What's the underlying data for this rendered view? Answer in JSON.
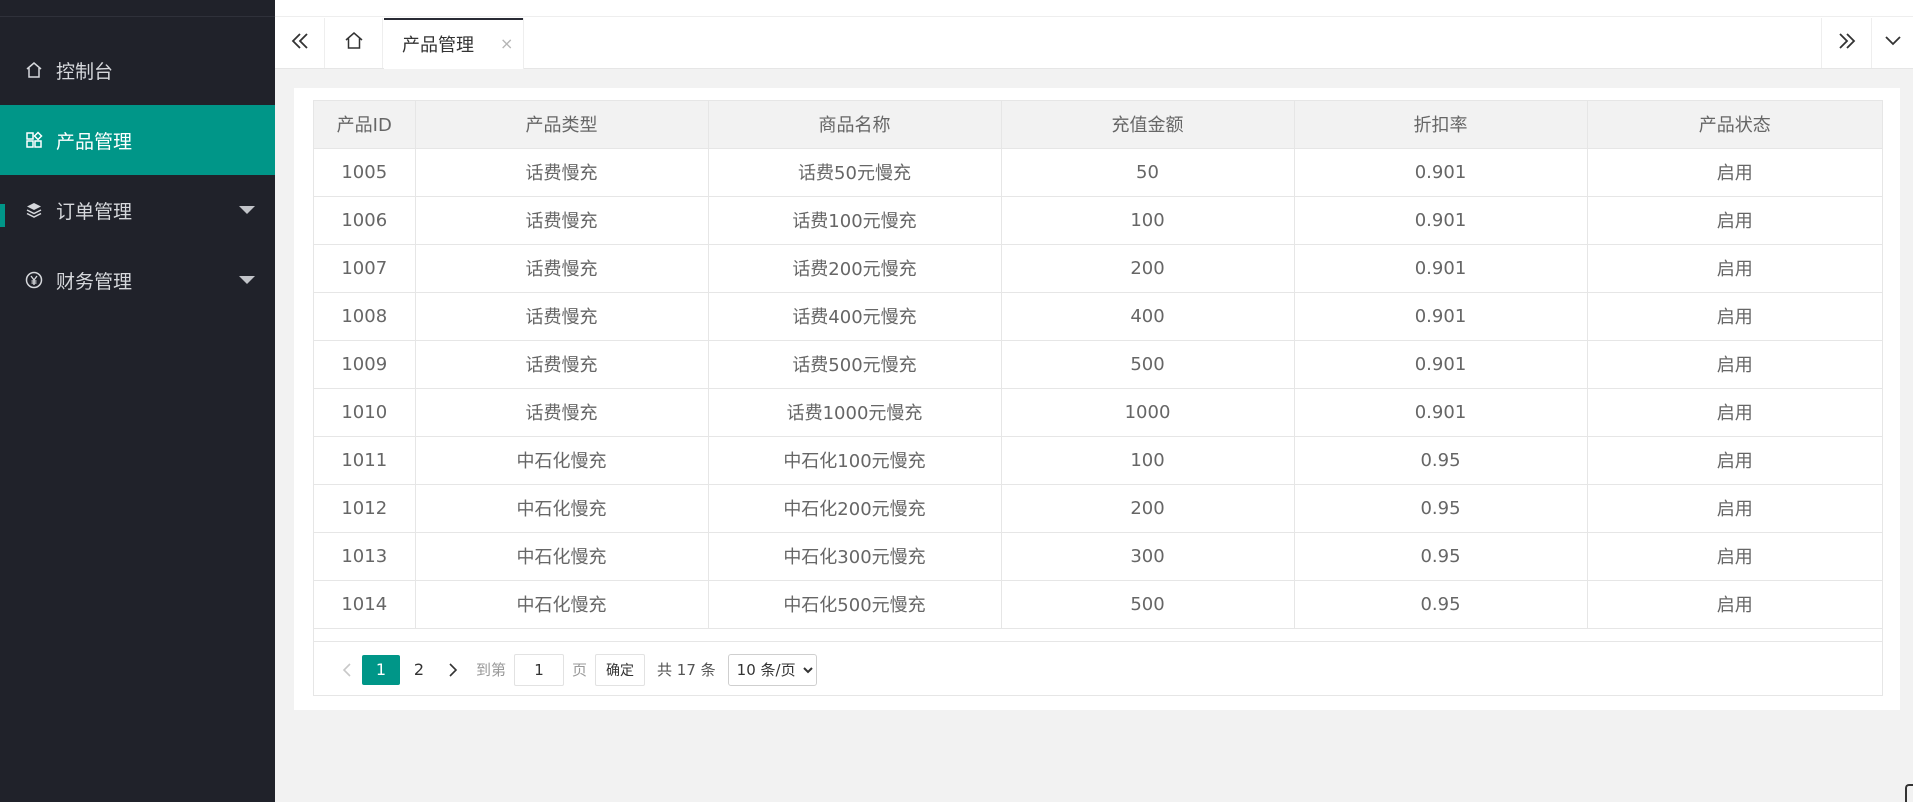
{
  "sidebar": {
    "items": [
      {
        "label": "控制台",
        "icon": "home-icon"
      },
      {
        "label": "产品管理",
        "icon": "app-grid-icon",
        "active": true
      },
      {
        "label": "订单管理",
        "icon": "layers-icon",
        "has_submenu": true
      },
      {
        "label": "财务管理",
        "icon": "yen-circle-icon",
        "has_submenu": true
      }
    ]
  },
  "tabs": {
    "active_label": "产品管理",
    "close_glyph": "×"
  },
  "table": {
    "headers": [
      "产品ID",
      "产品类型",
      "商品名称",
      "充值金额",
      "折扣率",
      "产品状态"
    ],
    "rows": [
      [
        "1005",
        "话费慢充",
        "话费50元慢充",
        "50",
        "0.901",
        "启用"
      ],
      [
        "1006",
        "话费慢充",
        "话费100元慢充",
        "100",
        "0.901",
        "启用"
      ],
      [
        "1007",
        "话费慢充",
        "话费200元慢充",
        "200",
        "0.901",
        "启用"
      ],
      [
        "1008",
        "话费慢充",
        "话费400元慢充",
        "400",
        "0.901",
        "启用"
      ],
      [
        "1009",
        "话费慢充",
        "话费500元慢充",
        "500",
        "0.901",
        "启用"
      ],
      [
        "1010",
        "话费慢充",
        "话费1000元慢充",
        "1000",
        "0.901",
        "启用"
      ],
      [
        "1011",
        "中石化慢充",
        "中石化100元慢充",
        "100",
        "0.95",
        "启用"
      ],
      [
        "1012",
        "中石化慢充",
        "中石化200元慢充",
        "200",
        "0.95",
        "启用"
      ],
      [
        "1013",
        "中石化慢充",
        "中石化300元慢充",
        "300",
        "0.95",
        "启用"
      ],
      [
        "1014",
        "中石化慢充",
        "中石化500元慢充",
        "500",
        "0.95",
        "启用"
      ]
    ]
  },
  "pagination": {
    "pages": [
      "1",
      "2"
    ],
    "current": "1",
    "goto_prefix": "到第",
    "goto_value": "1",
    "goto_suffix": "页",
    "confirm_label": "确定",
    "total_text": "共 17 条",
    "page_size_selected": "10 条/页"
  },
  "colors": {
    "sidebar_bg": "#20222a",
    "accent": "#009688",
    "header_bg": "#f2f2f2"
  }
}
